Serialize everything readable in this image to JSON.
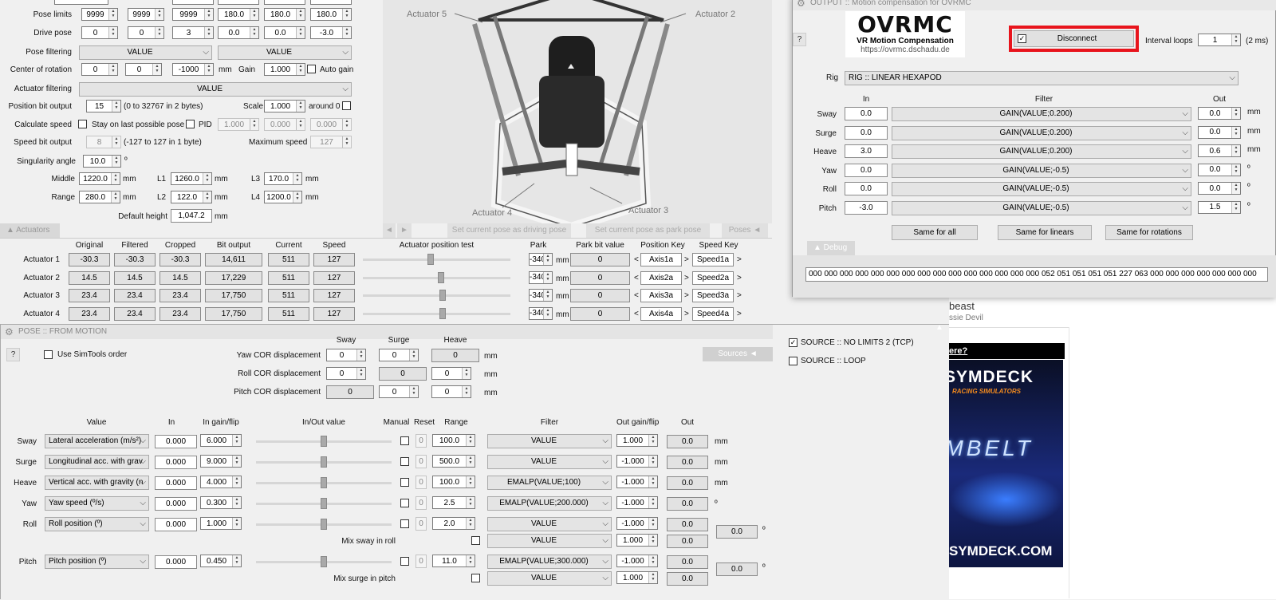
{
  "top": {
    "pose_limits_label": "Pose limits",
    "pose_limits": [
      "9999",
      "9999",
      "9999",
      "180.0",
      "180.0",
      "180.0"
    ],
    "drive_pose_label": "Drive pose",
    "drive_pose": [
      "0",
      "0",
      "3",
      "0.0",
      "0.0",
      "-3.0"
    ],
    "pose_filtering_label": "Pose filtering",
    "pose_filtering": [
      "VALUE",
      "VALUE"
    ],
    "cor_label": "Center of rotation",
    "cor": [
      "0",
      "0",
      "-1000"
    ],
    "cor_unit": "mm",
    "gain_label": "Gain",
    "gain": "1.000",
    "auto_gain_label": "Auto gain",
    "actuator_filtering_label": "Actuator filtering",
    "actuator_filtering": "VALUE",
    "pos_bit_label": "Position bit output",
    "pos_bit": "15",
    "pos_bit_note": "(0 to 32767 in 2 bytes)",
    "scale_label": "Scale",
    "scale": "1.000",
    "around0_label": "around 0",
    "calc_speed_label": "Calculate speed",
    "stay_label": "Stay on last possible pose",
    "pid_label": "PID",
    "pid": [
      "1.000",
      "0.000",
      "0.000"
    ],
    "speed_bit_label": "Speed bit output",
    "speed_bit": "8",
    "speed_bit_note": "(-127 to 127 in 1 byte)",
    "max_speed_label": "Maximum speed",
    "max_speed": "127",
    "sing_label": "Singularity angle",
    "sing": "10.0",
    "sing_unit": "º",
    "middle_label": "Middle",
    "middle": "1220.0",
    "range_label": "Range",
    "range": "280.0",
    "l1_label": "L1",
    "l1": "1260.0",
    "l2_label": "L2",
    "l2": "122.0",
    "l3_label": "L3",
    "l3": "170.0",
    "l4_label": "L4",
    "l4": "1200.0",
    "mm": "mm",
    "default_height_label": "Default height",
    "default_height": "1,047.2"
  },
  "viewer": {
    "act5": "Actuator 5",
    "act2": "Actuator 2",
    "act4": "Actuator 4",
    "act3": "Actuator 3",
    "nav_left": "◄",
    "nav_right": "►",
    "set_driving": "Set current pose as driving pose",
    "set_park": "Set current pose as park pose",
    "poses_tab": "Poses ◄"
  },
  "actuators": {
    "header": "▲ Actuators",
    "cols": [
      "Original",
      "Filtered",
      "Cropped",
      "Bit output",
      "Current",
      "Speed"
    ],
    "test_label": "Actuator position test",
    "park_label": "Park",
    "park_bit_label": "Park bit value",
    "pos_key_label": "Position Key",
    "speed_key_label": "Speed Key",
    "rows": [
      {
        "name": "Actuator 1",
        "vals": [
          "-30.3",
          "-30.3",
          "-30.3",
          "14,611",
          "511",
          "127"
        ],
        "park": "-340",
        "park_bit": "0",
        "pos_key": "Axis1a",
        "speed_key": "Speed1a",
        "slider": 0.46
      },
      {
        "name": "Actuator 2",
        "vals": [
          "14.5",
          "14.5",
          "14.5",
          "17,229",
          "511",
          "127"
        ],
        "park": "-340",
        "park_bit": "0",
        "pos_key": "Axis2a",
        "speed_key": "Speed2a",
        "slider": 0.53
      },
      {
        "name": "Actuator 3",
        "vals": [
          "23.4",
          "23.4",
          "23.4",
          "17,750",
          "511",
          "127"
        ],
        "park": "-340",
        "park_bit": "0",
        "pos_key": "Axis3a",
        "speed_key": "Speed3a",
        "slider": 0.54
      },
      {
        "name": "Actuator 4",
        "vals": [
          "23.4",
          "23.4",
          "23.4",
          "17,750",
          "511",
          "127"
        ],
        "park": "-340",
        "park_bit": "0",
        "pos_key": "Axis4a",
        "speed_key": "Speed4a",
        "slider": 0.54
      }
    ],
    "mm": "mm",
    "lt": "<",
    "gt": ">"
  },
  "pose": {
    "title": "POSE :: FROM MOTION",
    "help": "?",
    "simtools_label": "Use SimTools order",
    "sources_tab": "Sources ◄",
    "disp_cols": [
      "Sway",
      "Surge",
      "Heave"
    ],
    "yaw_cor_label": "Yaw COR displacement",
    "yaw_cor": [
      "0",
      "0",
      "0"
    ],
    "roll_cor_label": "Roll COR displacement",
    "roll_cor": [
      "0",
      "0",
      "0"
    ],
    "pitch_cor_label": "Pitch COR displacement",
    "pitch_cor": [
      "0",
      "0",
      "0"
    ],
    "mm": "mm",
    "cols": {
      "value": "Value",
      "in": "In",
      "in_gain": "In gain/flip",
      "inout": "In/Out value",
      "manual": "Manual",
      "reset": "Reset",
      "range": "Range",
      "filter": "Filter",
      "out_gain": "Out gain/flip",
      "out": "Out"
    },
    "rows": [
      {
        "name": "Sway",
        "value": "Lateral acceleration (m/s²)",
        "in": "0.000",
        "in_gain": "6.000",
        "range": "100.0",
        "filter": "VALUE",
        "out_gain": "1.000",
        "out": "0.0",
        "unit": "mm",
        "slider": 0.5
      },
      {
        "name": "Surge",
        "value": "Longitudinal acc. with grav",
        "in": "0.000",
        "in_gain": "9.000",
        "range": "500.0",
        "filter": "VALUE",
        "out_gain": "-1.000",
        "out": "0.0",
        "unit": "mm",
        "slider": 0.5
      },
      {
        "name": "Heave",
        "value": "Vertical acc. with gravity (n",
        "in": "0.000",
        "in_gain": "4.000",
        "range": "100.0",
        "filter": "EMALP(VALUE;100)",
        "out_gain": "-1.000",
        "out": "0.0",
        "unit": "mm",
        "slider": 0.5
      },
      {
        "name": "Yaw",
        "value": "Yaw speed (º/s)",
        "in": "0.000",
        "in_gain": "0.300",
        "range": "2.5",
        "filter": "EMALP(VALUE;200.000)",
        "out_gain": "-1.000",
        "out": "0.0",
        "unit": "º",
        "slider": 0.5
      },
      {
        "name": "Roll",
        "value": "Roll position (º)",
        "in": "0.000",
        "in_gain": "1.000",
        "range": "2.0",
        "filter": "VALUE",
        "out_gain": "-1.000",
        "out": "0.0",
        "unit": "",
        "slider": 0.5
      },
      {
        "name": "Pitch",
        "value": "Pitch position (º)",
        "in": "0.000",
        "in_gain": "0.450",
        "range": "11.0",
        "filter": "EMALP(VALUE;300.000)",
        "out_gain": "-1.000",
        "out": "0.0",
        "unit": "",
        "slider": 0.5
      }
    ],
    "reset_val": "0",
    "mix_sway_label": "Mix sway in roll",
    "mix_sway_filter": "VALUE",
    "mix_sway_gain": "1.000",
    "mix_sway_out": "0.0",
    "mix_surge_label": "Mix surge in pitch",
    "mix_surge_filter": "VALUE",
    "mix_surge_gain": "1.000",
    "mix_surge_out": "0.0",
    "roll_total": "0.0",
    "pitch_total": "0.0",
    "deg": "º"
  },
  "sources": [
    {
      "label": "SOURCE :: NO LIMITS 2 (TCP)",
      "checked": true
    },
    {
      "label": "SOURCE :: LOOP",
      "checked": false
    }
  ],
  "output": {
    "title": "OUTPUT :: Motion compensation for OVRMC",
    "help": "?",
    "logo_title": "OVRMC",
    "logo_sub": "VR Motion Compensation",
    "logo_url": "https://ovrmc.dschadu.de",
    "disconnect": "Disconnect",
    "interval_label": "Interval loops",
    "interval": "1",
    "interval_note": "(2 ms)",
    "rig_label": "Rig",
    "rig": "RIG :: LINEAR HEXAPOD",
    "cols": {
      "in": "In",
      "filter": "Filter",
      "out": "Out"
    },
    "rows": [
      {
        "name": "Sway",
        "in": "0.0",
        "filter": "GAIN(VALUE;0.200)",
        "out": "0.0",
        "unit": "mm"
      },
      {
        "name": "Surge",
        "in": "0.0",
        "filter": "GAIN(VALUE;0.200)",
        "out": "0.0",
        "unit": "mm"
      },
      {
        "name": "Heave",
        "in": "3.0",
        "filter": "GAIN(VALUE;0.200)",
        "out": "0.6",
        "unit": "mm"
      },
      {
        "name": "Yaw",
        "in": "0.0",
        "filter": "GAIN(VALUE;-0.5)",
        "out": "0.0",
        "unit": "º"
      },
      {
        "name": "Roll",
        "in": "0.0",
        "filter": "GAIN(VALUE;-0.5)",
        "out": "0.0",
        "unit": "º"
      },
      {
        "name": "Pitch",
        "in": "-3.0",
        "filter": "GAIN(VALUE;-0.5)",
        "out": "1.5",
        "unit": "º"
      }
    ],
    "same_all": "Same for all",
    "same_linears": "Same for linears",
    "same_rotations": "Same for rotations",
    "debug_tab": "▲ Debug",
    "debug_text": "000 000 000 000 000 000 000 000 000 000 000 000 000 000 000 052 051 051 051 051 227 063 000 000 000 000 000 000 000"
  },
  "background_page": {
    "text1": "beast",
    "text2": "ssie Devil",
    "link": "ere?",
    "brand": "SYMDECK",
    "tag": "RACING SIMULATORS",
    "belt": "SIMBELT",
    "site": "SYMDECK.COM"
  },
  "colors": {
    "accent_red": "#e8141c",
    "panel_bg": "#f0f0f0"
  }
}
